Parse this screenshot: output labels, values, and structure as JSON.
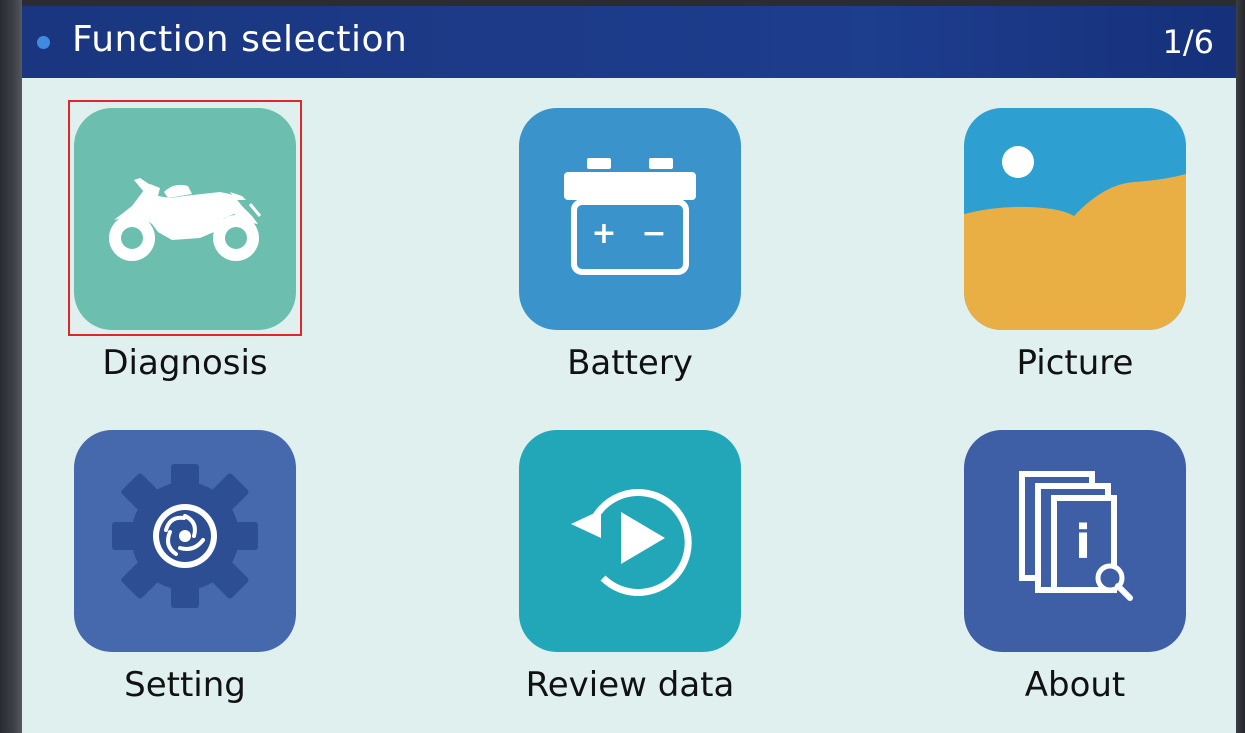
{
  "header": {
    "title": "Function selection",
    "page_indicator": "1/6"
  },
  "selected_tile": "Diagnosis",
  "tiles": [
    {
      "label": "Diagnosis",
      "icon": "motorcycle-icon",
      "color": "#6cbfae"
    },
    {
      "label": "Battery",
      "icon": "battery-icon",
      "color": "#3a93cb"
    },
    {
      "label": "Picture",
      "icon": "picture-icon",
      "color": "#2e9fd1"
    },
    {
      "label": "Setting",
      "icon": "gear-icon",
      "color": "#4668ad"
    },
    {
      "label": "Review data",
      "icon": "replay-icon",
      "color": "#22a7b8"
    },
    {
      "label": "About",
      "icon": "document-info-icon",
      "color": "#3e5fa6"
    }
  ],
  "battery_icon_symbols": {
    "plus": "+",
    "minus": "−"
  },
  "about_icon_symbol": "i",
  "colors": {
    "header_bg": "#1d3d8d",
    "screen_bg": "#dff0ef",
    "selection_border": "#e0262a",
    "picture_sand": "#e9ae44"
  }
}
